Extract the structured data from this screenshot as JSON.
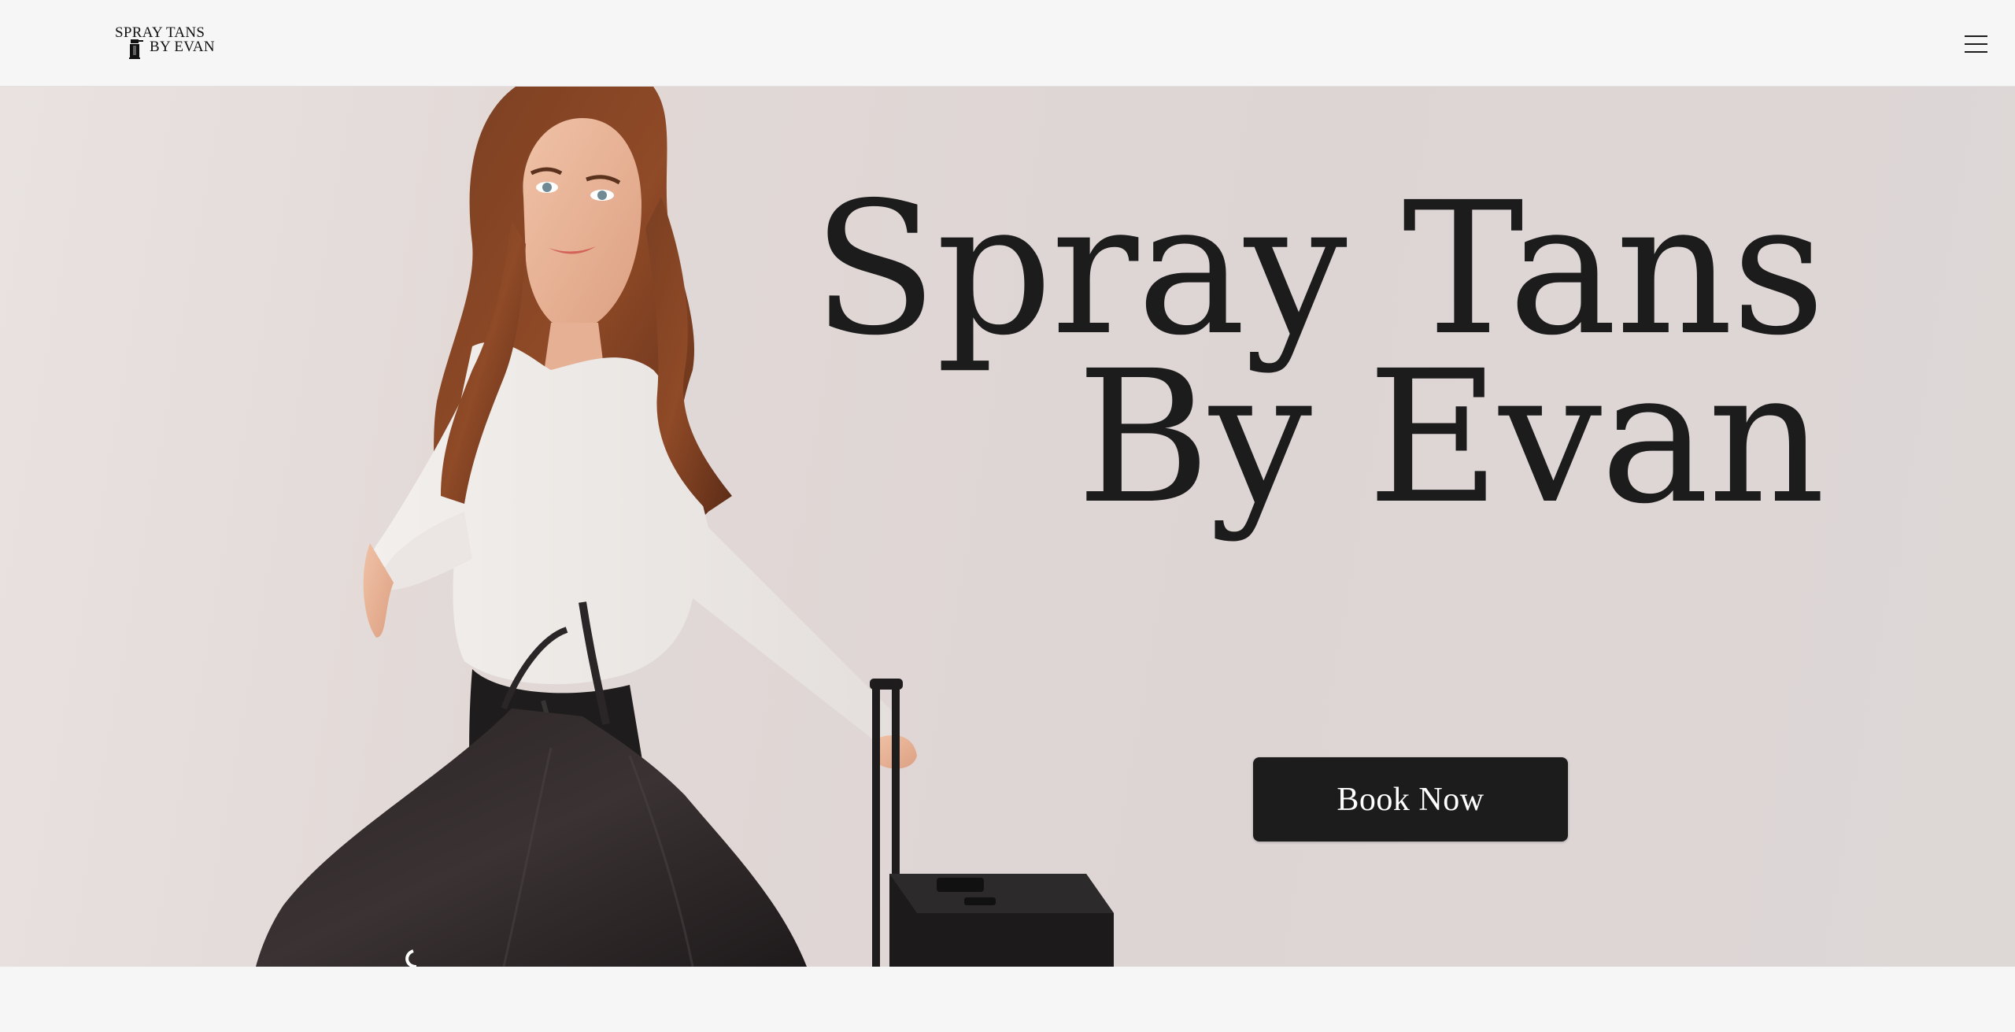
{
  "header": {
    "logo": {
      "line1": "SPRAY TANS",
      "line2": "BY EVAN"
    },
    "menu_icon": "hamburger-menu-icon"
  },
  "hero": {
    "title_line1": "Spray Tans",
    "title_line2": "By Evan",
    "cta_label": "Book Now",
    "photo_description_icon": "hero-photo",
    "colors": {
      "background": "#ddd6d5",
      "text": "#1c1c1c",
      "button": "#1c1c1c",
      "button_text": "#ffffff"
    }
  }
}
